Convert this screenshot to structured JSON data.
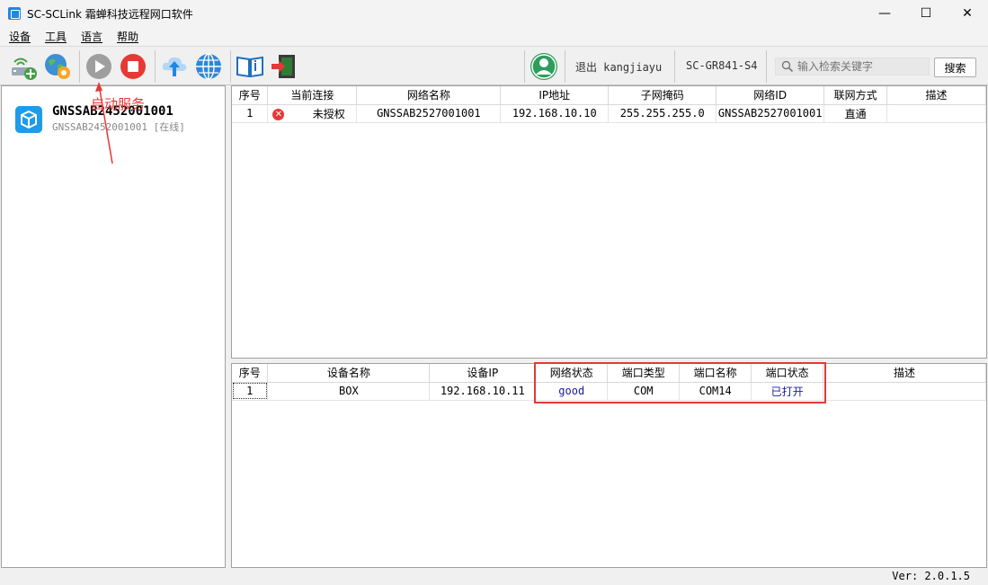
{
  "window": {
    "title": "SC-SCLink 霜蝉科技远程网口软件",
    "controls": {
      "minimize": "—",
      "maximize": "☐",
      "close": "✕"
    }
  },
  "menu": [
    "设备",
    "工具",
    "语言",
    "帮助"
  ],
  "toolbar": {
    "buttons": [
      "add-device-icon",
      "globe-settings-icon",
      "start-service-icon",
      "stop-service-icon",
      "upload-cloud-icon",
      "network-globe-icon",
      "manual-book-icon",
      "exit-door-icon",
      "user-avatar-icon"
    ],
    "logout_text": "退出 kangjiayu",
    "model": "SC-GR841-S4",
    "search_placeholder": "输入检索关键字",
    "search_button": "搜索"
  },
  "device_tree": {
    "name": "GNSSAB2452001001",
    "status": "GNSSAB2452001001 [在线]"
  },
  "annotation": {
    "text": "启动服务",
    "color": "#e53935"
  },
  "network_table": {
    "headers": [
      "序号",
      "当前连接",
      "网络名称",
      "IP地址",
      "子网掩码",
      "网络ID",
      "联网方式",
      "描述"
    ],
    "rows": [
      {
        "index": "1",
        "connection": "未授权",
        "name": "GNSSAB2527001001",
        "ip": "192.168.10.10",
        "mask": "255.255.255.0",
        "net_id": "GNSSAB2527001001",
        "mode": "直通",
        "desc": ""
      }
    ]
  },
  "device_table": {
    "headers": [
      "序号",
      "设备名称",
      "设备IP",
      "网络状态",
      "端口类型",
      "端口名称",
      "端口状态",
      "描述"
    ],
    "rows": [
      {
        "index": "1",
        "name": "BOX",
        "ip": "192.168.10.11",
        "net_status": "good",
        "port_type": "COM",
        "port_name": "COM14",
        "port_status": "已打开",
        "desc": ""
      }
    ]
  },
  "status_bar": {
    "version": "Ver: 2.0.1.5"
  }
}
